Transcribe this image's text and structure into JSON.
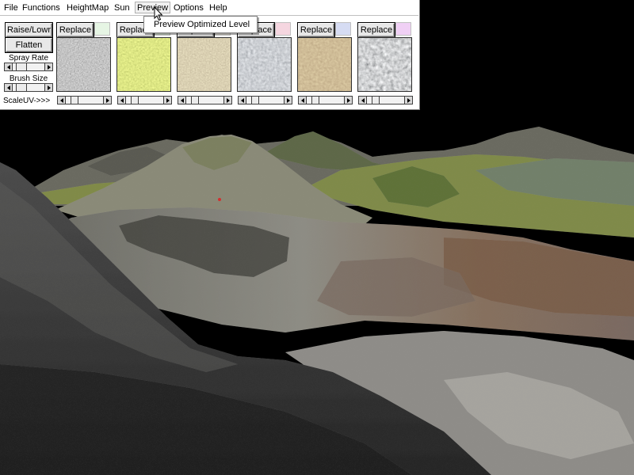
{
  "menubar": {
    "items": [
      {
        "label": "File"
      },
      {
        "label": "Functions"
      },
      {
        "label": "HeightMap"
      },
      {
        "label": "Sun"
      },
      {
        "label": "Preview"
      },
      {
        "label": "Options"
      },
      {
        "label": "Help"
      }
    ],
    "active_menu": "Preview"
  },
  "dropdown": {
    "items": [
      {
        "label": "Preview Optimized Level"
      }
    ]
  },
  "tools": {
    "raise_lower_label": "Raise/Lowr",
    "flatten_label": "Flatten",
    "spray_rate_label": "Spray Rate",
    "brush_size_label": "Brush Size",
    "scale_uv_label": "ScaleUV->>>"
  },
  "textures": [
    {
      "replace_label": "Replace",
      "swatch_color": "#e6f5e4",
      "texture": "gray-gravel"
    },
    {
      "replace_label": "Replace",
      "swatch_color": "#e6f5e4",
      "texture": "green-grass"
    },
    {
      "replace_label": "Replace",
      "swatch_color": "#f3efe6",
      "texture": "brown-dirt"
    },
    {
      "replace_label": "Replace",
      "swatch_color": "#f5d6e0",
      "texture": "gray-rock"
    },
    {
      "replace_label": "Replace",
      "swatch_color": "#d6dcf3",
      "texture": "brown-mud"
    },
    {
      "replace_label": "Replace",
      "swatch_color": "#f0d0f5",
      "texture": "dark-stone"
    }
  ],
  "colors": {
    "panel_bg": "#ffffff",
    "sky": "#000000",
    "terrain_gray": "#8a8a80",
    "terrain_green": "#7d8a48",
    "terrain_brown": "#7a5c40"
  }
}
